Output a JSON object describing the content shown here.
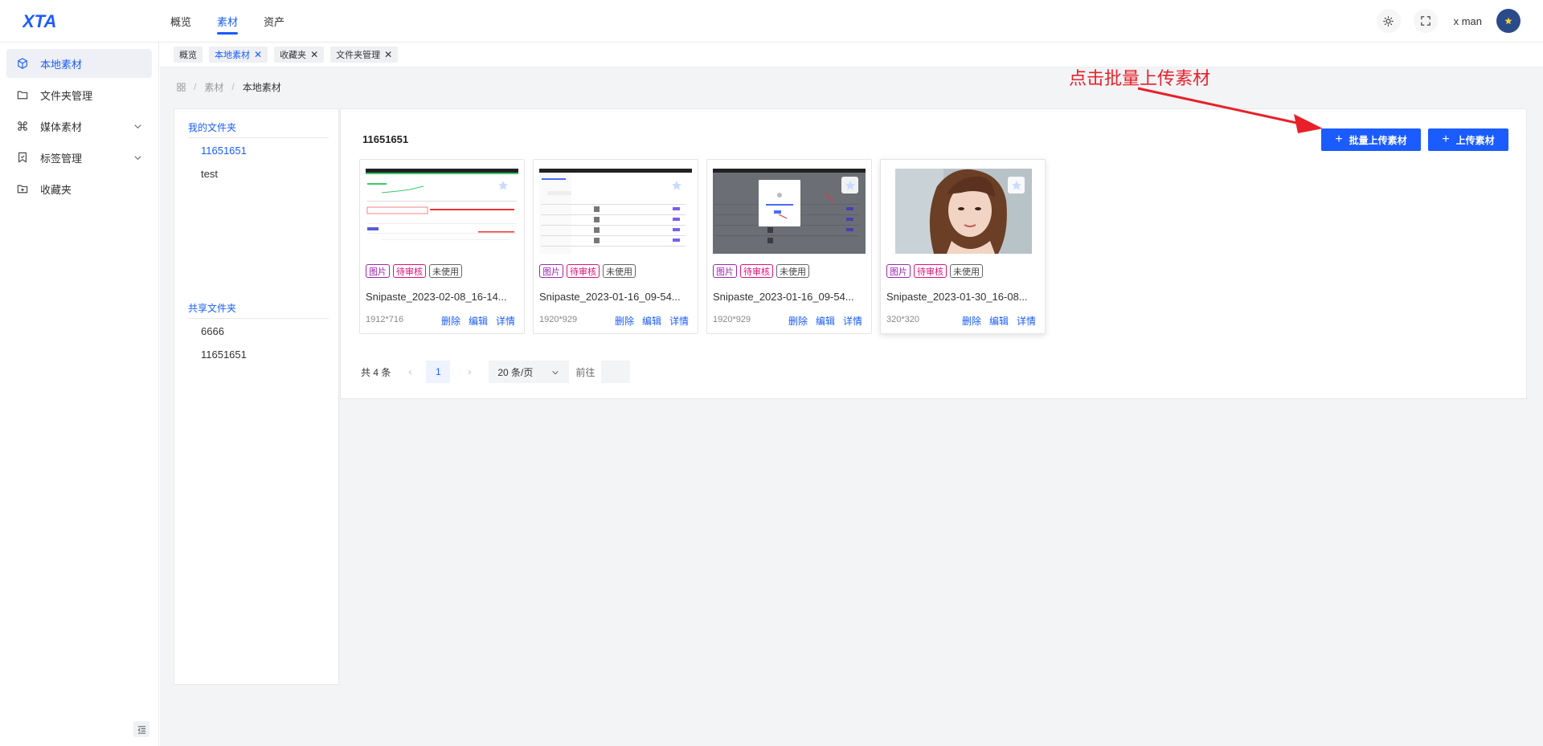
{
  "header": {
    "logo_text": "XTA",
    "nav": [
      {
        "label": "概览",
        "active": false
      },
      {
        "label": "素材",
        "active": true
      },
      {
        "label": "资产",
        "active": false
      }
    ],
    "username": "x man",
    "accent_color": "#1a5cff"
  },
  "sidebar": {
    "items": [
      {
        "label": "本地素材",
        "icon": "cube-icon",
        "active": true
      },
      {
        "label": "文件夹管理",
        "icon": "folder-icon",
        "active": false
      },
      {
        "label": "媒体素材",
        "icon": "command-icon",
        "active": false,
        "expandable": true
      },
      {
        "label": "标签管理",
        "icon": "bookmark-icon",
        "active": false,
        "expandable": true
      },
      {
        "label": "收藏夹",
        "icon": "folder-plus-icon",
        "active": false
      }
    ]
  },
  "tabs": [
    {
      "label": "概览",
      "closable": false,
      "active": false
    },
    {
      "label": "本地素材",
      "closable": true,
      "active": true
    },
    {
      "label": "收藏夹",
      "closable": true,
      "active": false
    },
    {
      "label": "文件夹管理",
      "closable": true,
      "active": false
    }
  ],
  "breadcrumb": {
    "items": [
      "素材",
      "本地素材"
    ]
  },
  "folders": {
    "my_title": "我的文件夹",
    "my_items": [
      {
        "label": "11651651",
        "active": true
      },
      {
        "label": "test",
        "active": false
      }
    ],
    "shared_title": "共享文件夹",
    "shared_items": [
      {
        "label": "6666",
        "active": false
      },
      {
        "label": "11651651",
        "active": false
      }
    ]
  },
  "content": {
    "folder_name": "11651651",
    "batch_upload_label": "批量上传素材",
    "upload_label": "上传素材",
    "cards": [
      {
        "title": "Snipaste_2023-02-08_16-14...",
        "size": "1912*716",
        "tags": [
          "图片",
          "待审核",
          "未使用"
        ]
      },
      {
        "title": "Snipaste_2023-01-16_09-54...",
        "size": "1920*929",
        "tags": [
          "图片",
          "待审核",
          "未使用"
        ]
      },
      {
        "title": "Snipaste_2023-01-16_09-54...",
        "size": "1920*929",
        "tags": [
          "图片",
          "待审核",
          "未使用"
        ]
      },
      {
        "title": "Snipaste_2023-01-30_16-08...",
        "size": "320*320",
        "tags": [
          "图片",
          "待审核",
          "未使用"
        ]
      }
    ],
    "actions": {
      "delete": "删除",
      "edit": "编辑",
      "detail": "详情"
    }
  },
  "pagination": {
    "total": "共 4 条",
    "current_page": "1",
    "page_size": "20 条/页",
    "goto_label": "前往",
    "goto_value": ""
  },
  "annotation": {
    "text": "点击批量上传素材",
    "color": "#e8202a"
  }
}
